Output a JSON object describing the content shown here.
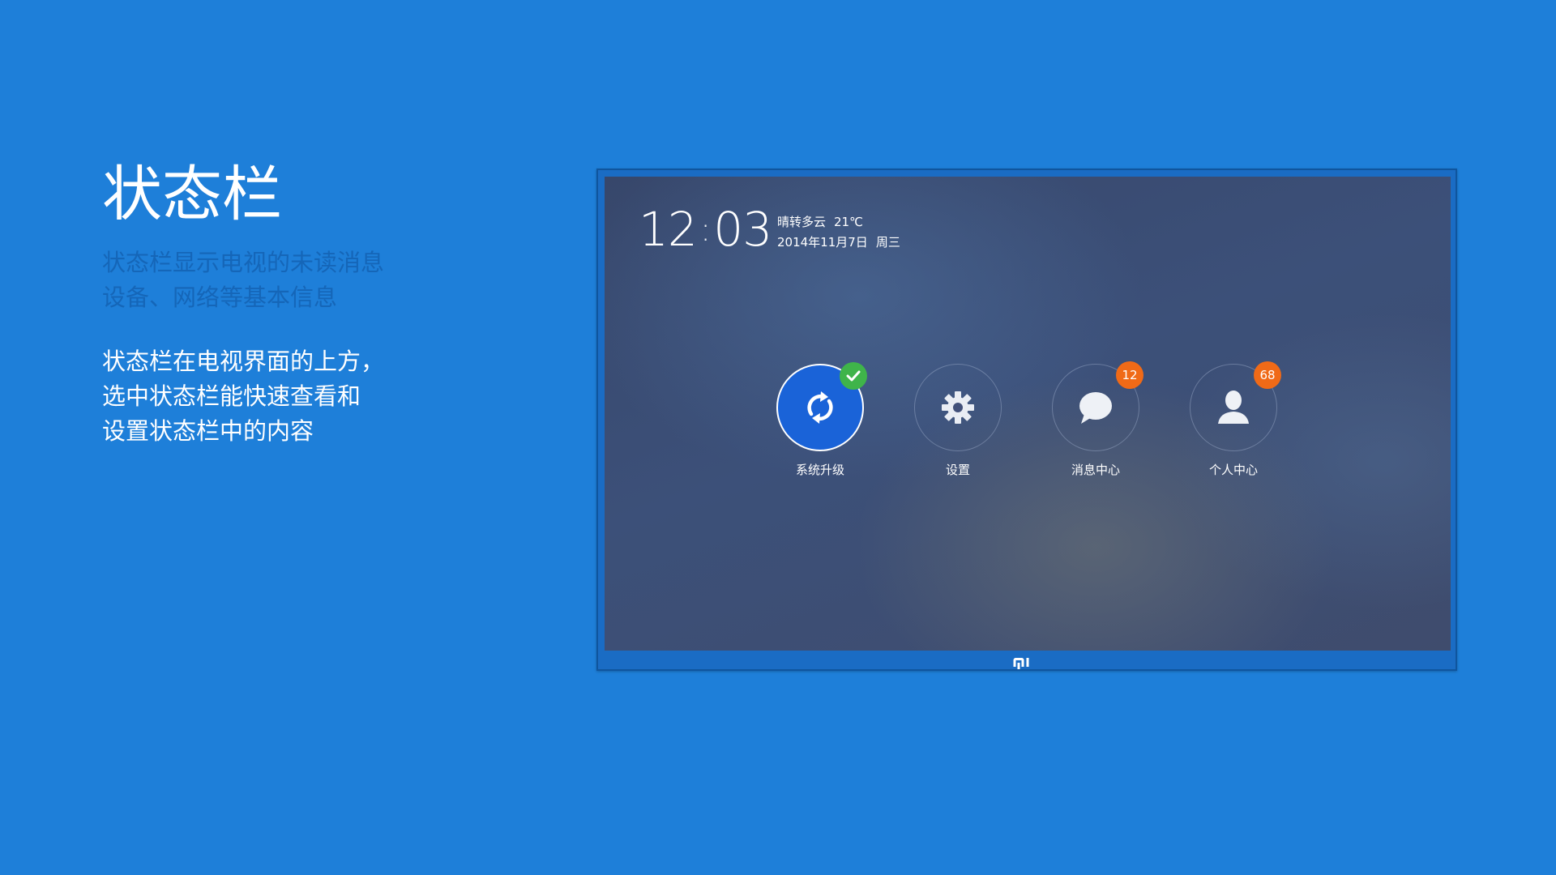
{
  "page": {
    "title": "状态栏",
    "subtitle_lines": [
      "状态栏显示电视的未读消息",
      "设备、网络等基本信息"
    ],
    "description_lines": [
      "状态栏在电视界面的上方，",
      "选中状态栏能快速查看和",
      "设置状态栏中的内容"
    ]
  },
  "tv": {
    "time_hour": "12",
    "time_minute": "03",
    "weather": "晴转多云",
    "temperature": "21℃",
    "date": "2014年11月7日",
    "weekday": "周三",
    "buttons": [
      {
        "label": "系统升级",
        "icon": "refresh-icon",
        "badge_icon": "check-icon",
        "active": true
      },
      {
        "label": "设置",
        "icon": "gear-icon"
      },
      {
        "label": "消息中心",
        "icon": "chat-bubble-icon",
        "badge": "12"
      },
      {
        "label": "个人中心",
        "icon": "user-icon",
        "badge": "68"
      }
    ],
    "brand": "mi-logo"
  },
  "colors": {
    "background": "#1e7fd9",
    "subtitle": "#1566b8",
    "active_button": "#1a63d8",
    "badge_orange": "#f06a17",
    "badge_green": "#3fb44a"
  }
}
